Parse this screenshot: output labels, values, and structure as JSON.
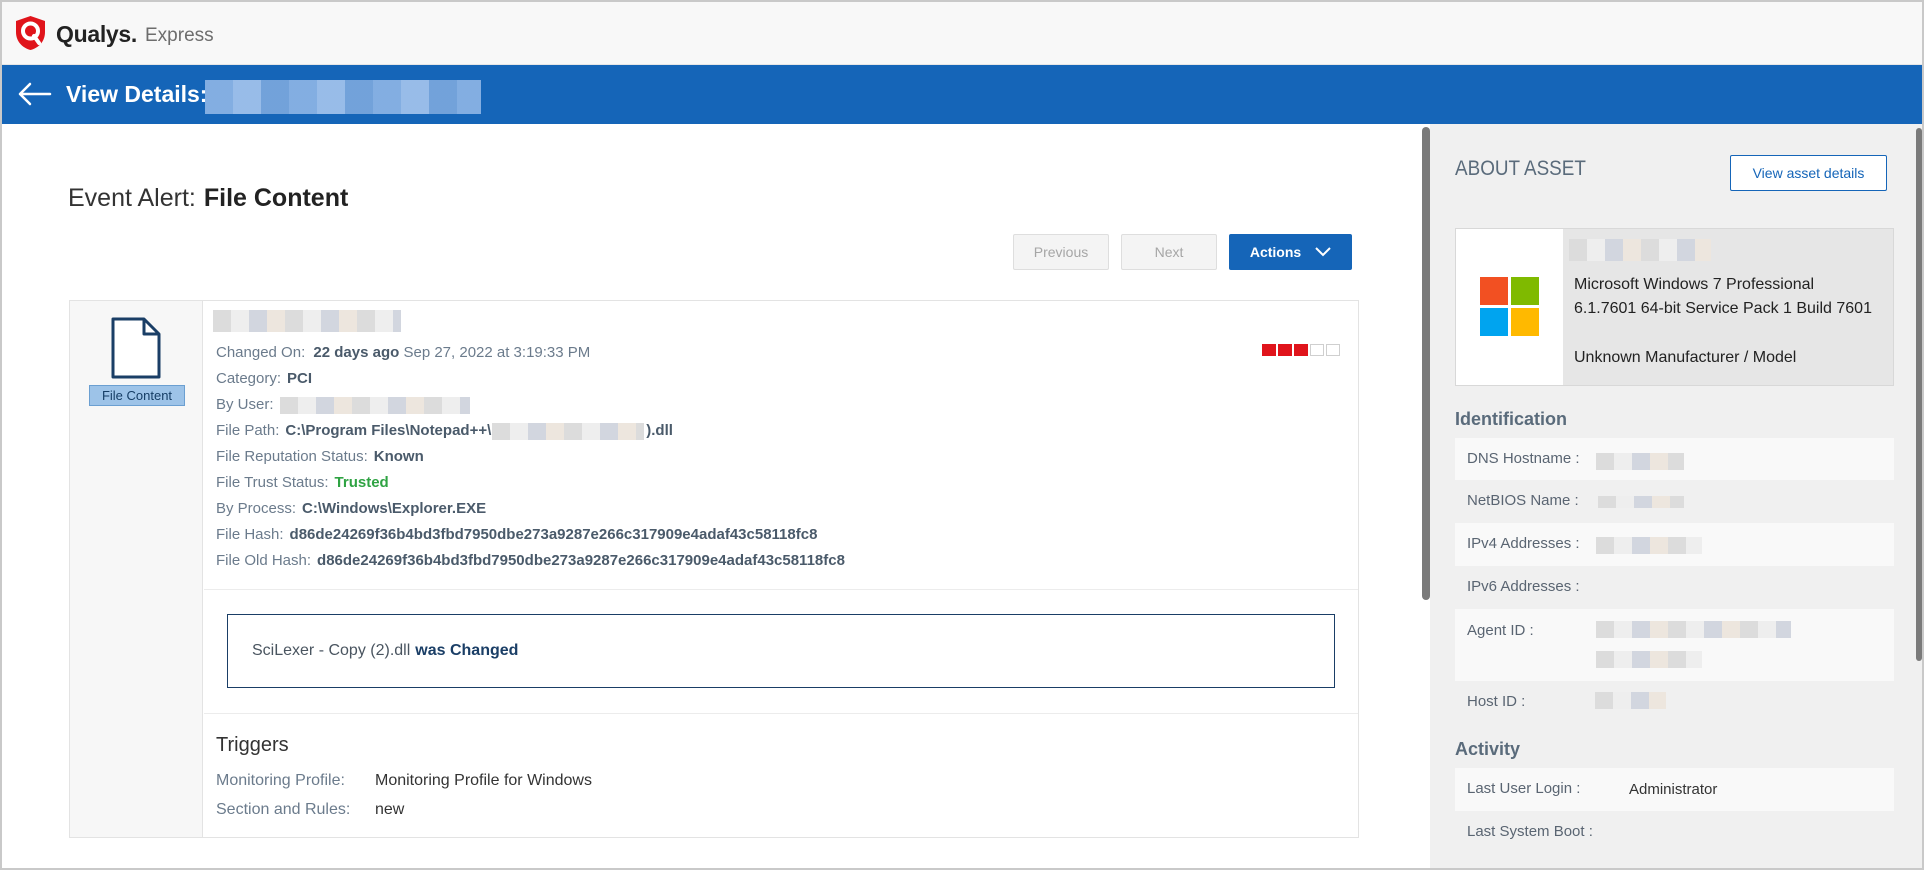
{
  "brand": {
    "name": "Qualys.",
    "product": "Express",
    "color": "#e0141b"
  },
  "header": {
    "title": "View Details:",
    "color": "#1565b8"
  },
  "event": {
    "title_prefix": "Event Alert:",
    "title_type": "File Content",
    "icon": "file-icon",
    "badge": "File Content",
    "buttons": {
      "previous": "Previous",
      "next": "Next",
      "actions": "Actions"
    },
    "severity": {
      "level": 3,
      "max": 5,
      "color": "#e0141b"
    },
    "changed_on_label": "Changed On:",
    "changed_ago": "22 days ago",
    "changed_date": "Sep 27, 2022 at 3:19:33 PM",
    "category_label": "Category:",
    "category": "PCI",
    "by_user_label": "By User:",
    "file_path_label": "File Path:",
    "file_path_start": "C:\\Program Files\\Notepad++\\",
    "file_path_end": ").dll",
    "reputation_label": "File Reputation Status:",
    "reputation": "Known",
    "trust_label": "File Trust Status:",
    "trust": "Trusted",
    "process_label": "By Process:",
    "process": "C:\\Windows\\Explorer.EXE",
    "hash_label": "File Hash:",
    "hash": "d86de24269f36b4bd3fbd7950dbe273a9287e266c317909e4adaf43c58118fc8",
    "old_hash_label": "File Old Hash:",
    "old_hash": "d86de24269f36b4bd3fbd7950dbe273a9287e266c317909e4adaf43c58118fc8",
    "change_file": "SciLexer - Copy (2).dll",
    "change_action": "was Changed"
  },
  "triggers": {
    "title": "Triggers",
    "profile_label": "Monitoring Profile:",
    "profile": "Monitoring Profile for Windows",
    "rules_label": "Section and Rules:",
    "rules": "new"
  },
  "asset": {
    "title": "ABOUT ASSET",
    "view_button": "View asset details",
    "os": "Microsoft Windows 7 Professional 6.1.7601 64-bit Service Pack 1 Build 7601",
    "manufacturer": "Unknown Manufacturer / Model",
    "identification_title": "Identification",
    "dns_label": "DNS Hostname :",
    "netbios_label": "NetBIOS Name :",
    "ipv4_label": "IPv4 Addresses :",
    "ipv6_label": "IPv6 Addresses :",
    "agent_label": "Agent ID :",
    "host_label": "Host ID :",
    "activity_title": "Activity",
    "last_login_label": "Last User Login :",
    "last_login": "Administrator",
    "last_boot_label": "Last System Boot :"
  }
}
